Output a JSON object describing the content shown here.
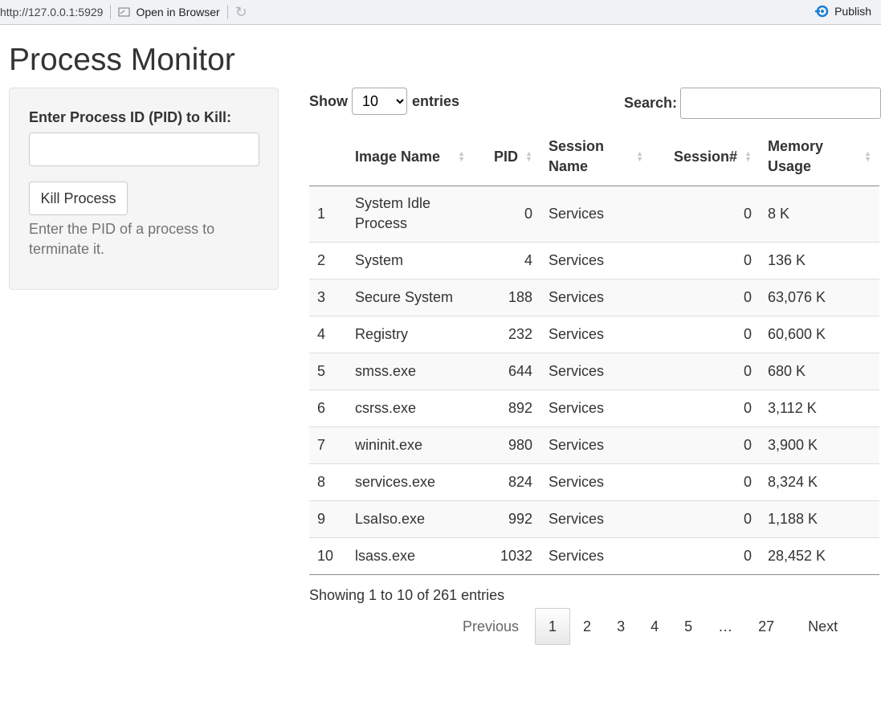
{
  "topbar": {
    "url": "http://127.0.0.1:5929",
    "open_label": "Open in Browser",
    "publish_label": "Publish"
  },
  "page_title": "Process Monitor",
  "sidebar": {
    "pid_label": "Enter Process ID (PID) to Kill:",
    "pid_value": "",
    "kill_button": "Kill Process",
    "help_text": "Enter the PID of a process to terminate it."
  },
  "controls": {
    "show_label": "Show",
    "page_length": "10",
    "entries_label": "entries",
    "search_label": "Search:",
    "search_value": ""
  },
  "table": {
    "columns": [
      "",
      "Image Name",
      "PID",
      "Session Name",
      "Session#",
      "Memory Usage"
    ],
    "rows": [
      [
        "1",
        "System Idle Process",
        "0",
        "Services",
        "0",
        "8 K"
      ],
      [
        "2",
        "System",
        "4",
        "Services",
        "0",
        "136 K"
      ],
      [
        "3",
        "Secure System",
        "188",
        "Services",
        "0",
        "63,076 K"
      ],
      [
        "4",
        "Registry",
        "232",
        "Services",
        "0",
        "60,600 K"
      ],
      [
        "5",
        "smss.exe",
        "644",
        "Services",
        "0",
        "680 K"
      ],
      [
        "6",
        "csrss.exe",
        "892",
        "Services",
        "0",
        "3,112 K"
      ],
      [
        "7",
        "wininit.exe",
        "980",
        "Services",
        "0",
        "3,900 K"
      ],
      [
        "8",
        "services.exe",
        "824",
        "Services",
        "0",
        "8,324 K"
      ],
      [
        "9",
        "LsaIso.exe",
        "992",
        "Services",
        "0",
        "1,188 K"
      ],
      [
        "10",
        "lsass.exe",
        "1032",
        "Services",
        "0",
        "28,452 K"
      ]
    ]
  },
  "info_text": "Showing 1 to 10 of 261 entries",
  "pagination": {
    "previous": "Previous",
    "pages": [
      "1",
      "2",
      "3",
      "4",
      "5",
      "…",
      "27"
    ],
    "current": "1",
    "next": "Next"
  },
  "colors": {
    "publish_accent": "#1a7fd6",
    "header_border": "#8a8a8a",
    "stripe": "#f9f9f9"
  }
}
